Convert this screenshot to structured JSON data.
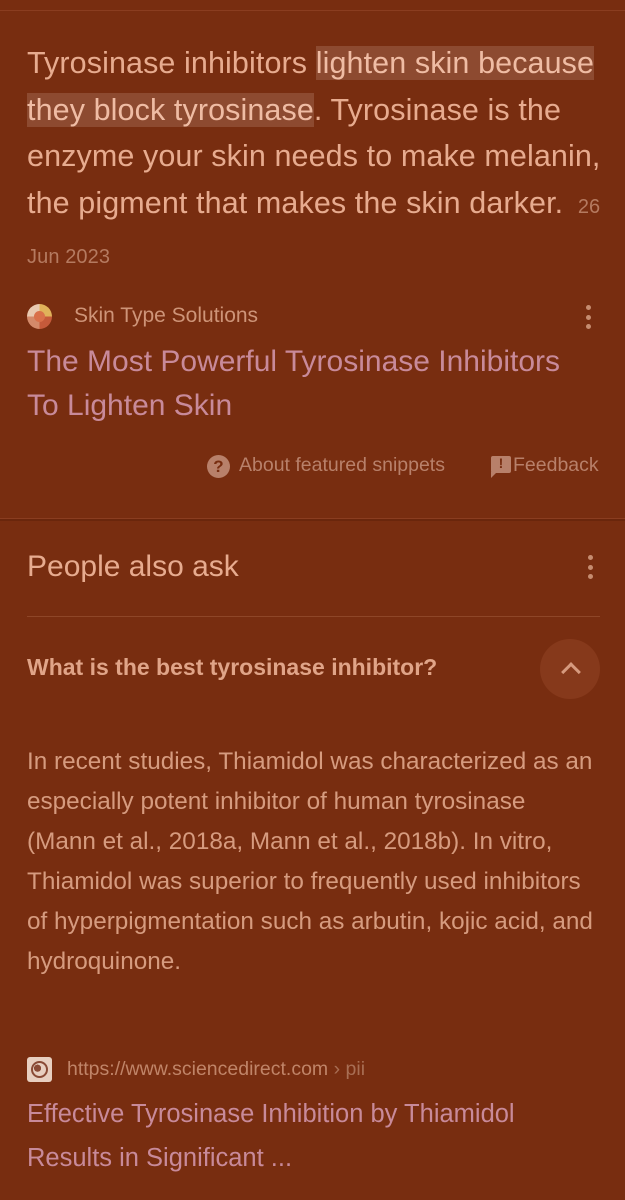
{
  "featured_snippet": {
    "text_before": "Tyrosinase inhibitors ",
    "highlight": "lighten skin because they block tyrosinase",
    "text_after": ". Tyrosinase is the enzyme your skin needs to make melanin, the pigment that makes the skin darker.",
    "date": "26 Jun 2023",
    "source_name": "Skin Type Solutions",
    "result_title": "The Most Powerful Tyrosinase Inhibitors To Lighten Skin",
    "about_label": "About featured snippets",
    "feedback_label": "Feedback"
  },
  "people_also_ask": {
    "title": "People also ask",
    "question": "What is the best tyrosinase inhibitor?",
    "answer": "In recent studies, Thiamidol was characterized as an especially potent inhibitor of human tyrosinase (Mann et al., 2018a, Mann et al., 2018b). In vitro, Thiamidol was superior to frequently used inhibitors of hyperpigmentation such as arbutin, kojic acid, and hydroquinone.",
    "source_url": "https://www.sciencedirect.com",
    "source_crumb": " › pii",
    "source_title": "Effective Tyrosinase Inhibition by Thiamidol Results in Significant ..."
  },
  "colors": {
    "background": "#782d10",
    "text": "#e7ab8f",
    "link": "#c88a9a",
    "highlight_bg": "#8d4a30"
  },
  "icons": {
    "snippet_menu": "more-vert-icon",
    "paa_menu": "more-vert-icon",
    "help": "help-circle-icon",
    "feedback": "feedback-icon",
    "collapse": "chevron-up-icon",
    "site_favicon": "site-favicon",
    "globe": "globe-icon"
  }
}
